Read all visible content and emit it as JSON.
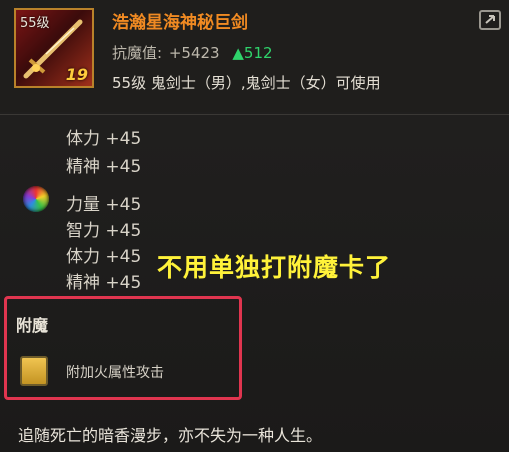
{
  "item": {
    "icon_level": "55级",
    "icon_count": "19",
    "name": "浩瀚星海神秘巨剑",
    "power_label": "抗魔值:",
    "power_value": "+5423",
    "power_diff": "▲512",
    "usable_by": "55级 鬼剑士（男）,鬼剑士（女）可使用"
  },
  "stats_group1": [
    "体力 +45",
    "精神 +45"
  ],
  "stats_group2": [
    "力量 +45",
    "智力 +45",
    "体力 +45",
    "精神 +45"
  ],
  "overlay_text": "不用单独打附魔卡了",
  "enchant": {
    "title": "附魔",
    "effect": "附加火属性攻击"
  },
  "flavor_text": "追随死亡的暗香漫步，亦不失为一种人生。",
  "colors": {
    "item_name": "#f08a22",
    "power_up": "#2fd36b",
    "overlay": "#fff23a",
    "highlight_box": "#e0354f"
  },
  "icons": [
    "sword-item-icon",
    "share-icon",
    "rainbow-orb-icon",
    "enchant-card-icon"
  ]
}
